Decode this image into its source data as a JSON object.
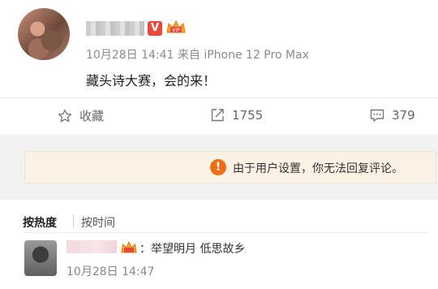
{
  "post": {
    "timestamp": "10月28日 14:41",
    "source": "来自 iPhone 12 Pro Max",
    "text": "藏头诗大赛，会的来！",
    "verified_badge": "V"
  },
  "actions": {
    "favorite_label": "收藏",
    "repost_count": "1755",
    "comment_count": "379"
  },
  "notice": {
    "icon": "!",
    "text": "由于用户设置，你无法回复评论。"
  },
  "comment_sort": {
    "hot": "按热度",
    "time": "按时间"
  },
  "comment": {
    "separator": "：",
    "text": "举望明月 低思故乡",
    "timestamp": "10月28日 14:47"
  },
  "colors": {
    "accent": "#ef6d16",
    "verified": "#e8483a",
    "notice_bg": "#fbf2e6"
  }
}
